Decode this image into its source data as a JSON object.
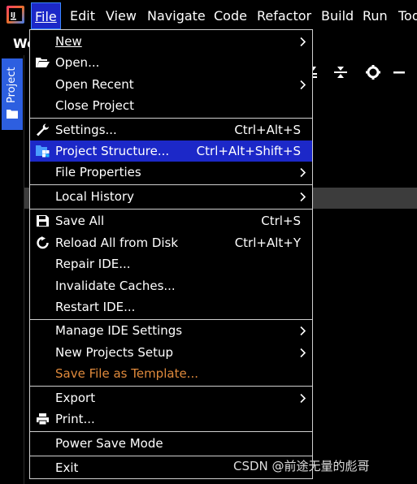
{
  "menubar": {
    "items": [
      {
        "label": "File"
      },
      {
        "label": "Edit"
      },
      {
        "label": "View"
      },
      {
        "label": "Navigate"
      },
      {
        "label": "Code"
      },
      {
        "label": "Refactor"
      },
      {
        "label": "Build"
      },
      {
        "label": "Run"
      },
      {
        "label": "Too"
      }
    ]
  },
  "background": {
    "title": "We",
    "project_tab": "Project"
  },
  "file_menu": {
    "new": {
      "label": "New",
      "icon": "none",
      "submenu": true
    },
    "open": {
      "label": "Open...",
      "icon": "folder-open-icon"
    },
    "open_recent": {
      "label": "Open Recent",
      "submenu": true
    },
    "close_project": {
      "label": "Close Project"
    },
    "settings": {
      "label": "Settings...",
      "shortcut": "Ctrl+Alt+S",
      "icon": "wrench-icon"
    },
    "project_structure": {
      "label": "Project Structure...",
      "shortcut": "Ctrl+Alt+Shift+S",
      "icon": "project-structure-icon"
    },
    "file_properties": {
      "label": "File Properties",
      "submenu": true
    },
    "local_history": {
      "label": "Local History",
      "submenu": true
    },
    "save_all": {
      "label": "Save All",
      "shortcut": "Ctrl+S",
      "icon": "save-icon"
    },
    "reload": {
      "label": "Reload All from Disk",
      "shortcut": "Ctrl+Alt+Y",
      "icon": "reload-icon"
    },
    "repair": {
      "label": "Repair IDE..."
    },
    "invalidate": {
      "label": "Invalidate Caches..."
    },
    "restart": {
      "label": "Restart IDE..."
    },
    "manage_settings": {
      "label": "Manage IDE Settings",
      "submenu": true
    },
    "new_projects_setup": {
      "label": "New Projects Setup",
      "submenu": true
    },
    "save_template": {
      "label": "Save File as Template...",
      "disabled": true
    },
    "export": {
      "label": "Export",
      "submenu": true
    },
    "print": {
      "label": "Print...",
      "icon": "printer-icon"
    },
    "power_save": {
      "label": "Power Save Mode"
    },
    "exit": {
      "label": "Exit"
    }
  },
  "watermark": "CSDN @前途无量的彪哥",
  "colors": {
    "highlight": "#1c28c8",
    "active_border": "#3a86ff",
    "disabled_text": "#e08a3c",
    "separator": "#cfcfcf",
    "tab_blue": "#2d5fe0"
  }
}
